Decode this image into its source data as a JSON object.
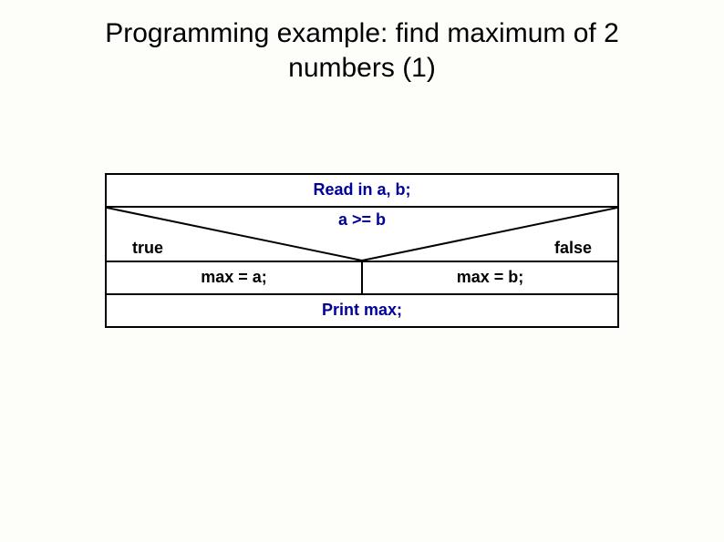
{
  "title_line1": "Programming example: find maximum of 2",
  "title_line2": "numbers (1)",
  "diagram": {
    "read": "Read in a, b;",
    "condition": "a >= b",
    "true_label": "true",
    "false_label": "false",
    "true_branch": "max = a;",
    "false_branch": "max = b;",
    "print": "Print max;"
  }
}
